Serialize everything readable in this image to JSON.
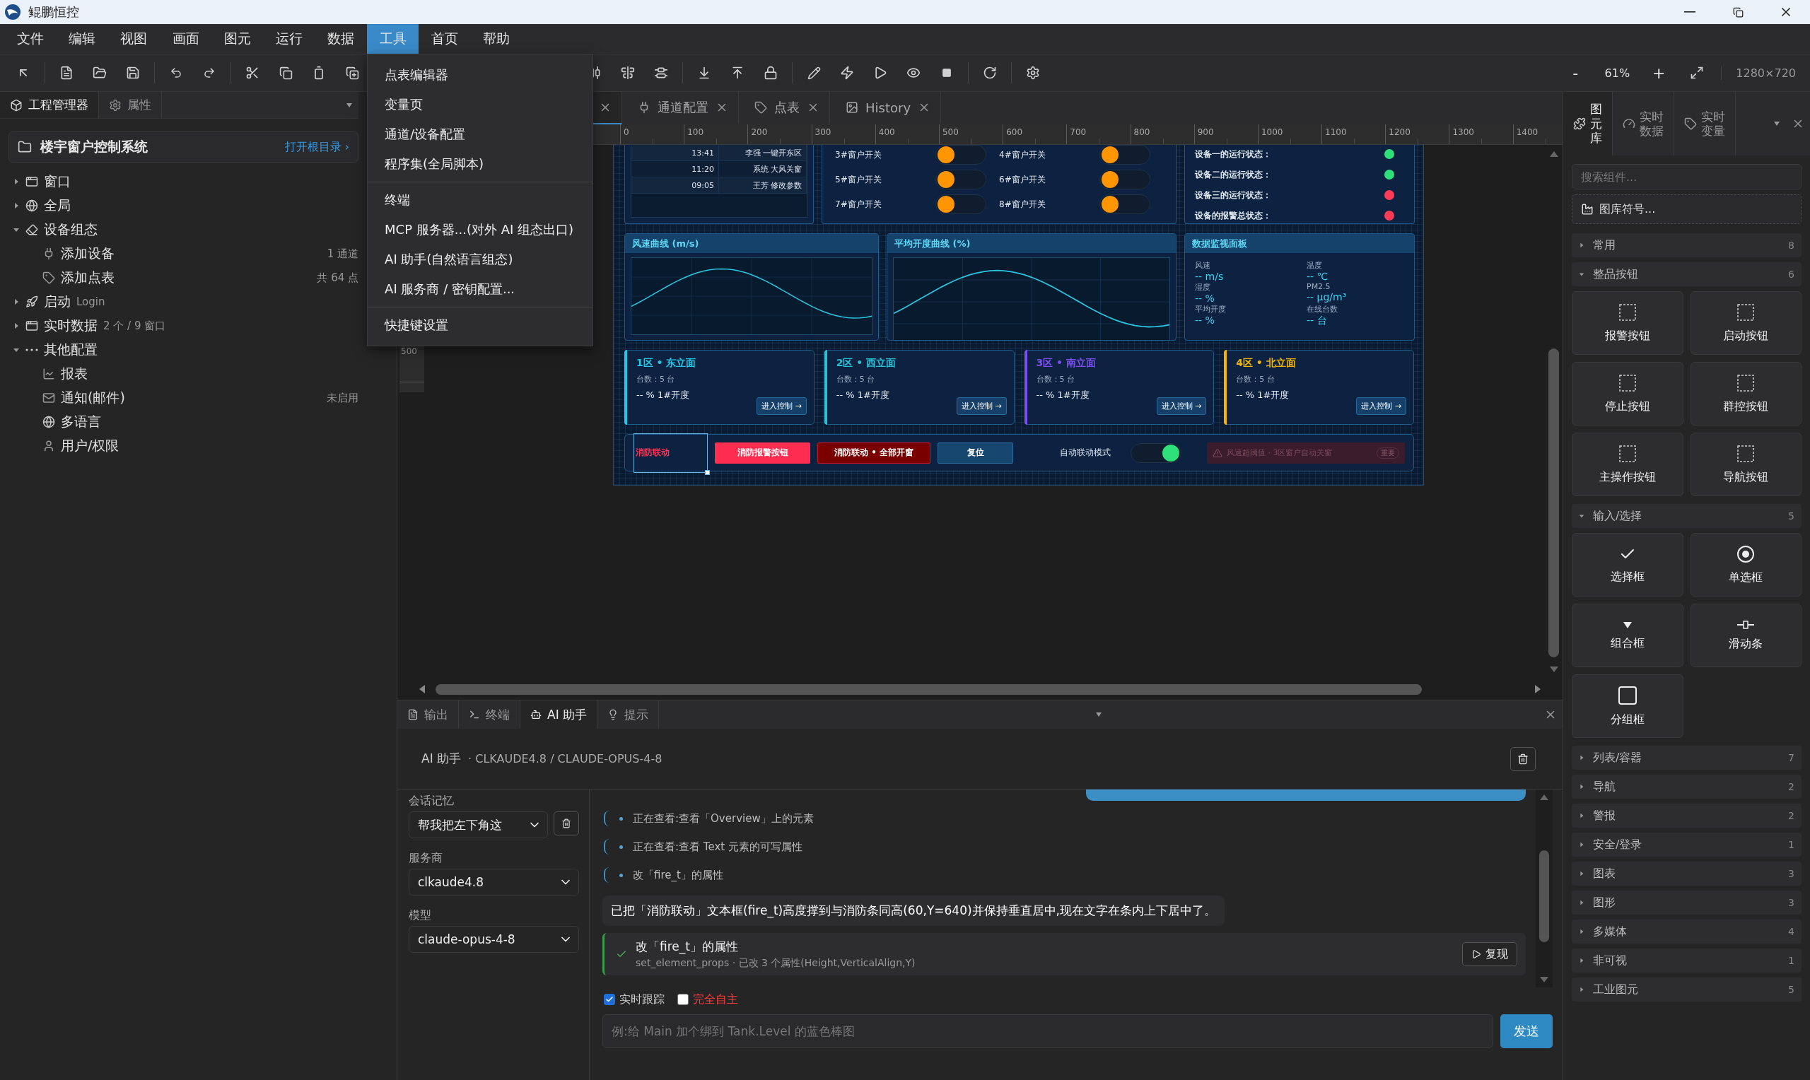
{
  "window": {
    "title": "鲲鹏恒控"
  },
  "menu": [
    {
      "label": "文件",
      "selected": false
    },
    {
      "label": "编辑",
      "selected": false
    },
    {
      "label": "视图",
      "selected": false
    },
    {
      "label": "画面",
      "selected": false
    },
    {
      "label": "图元",
      "selected": false
    },
    {
      "label": "运行",
      "selected": false
    },
    {
      "label": "数据",
      "selected": false
    },
    {
      "label": "工具",
      "selected": true
    },
    {
      "label": "首页",
      "selected": false
    },
    {
      "label": "帮助",
      "selected": false
    }
  ],
  "tools_menu": {
    "groups": [
      {
        "items": [
          "点表编辑器",
          "变量页",
          "通道/设备配置",
          "程序集(全局脚本)"
        ]
      },
      {
        "items": [
          "终端",
          "MCP 服务器...(对外 AI 组态出口)",
          "AI 助手(自然语言组态)",
          "AI 服务商 / 密钥配置..."
        ]
      },
      {
        "items": [
          "快捷键设置"
        ]
      }
    ]
  },
  "zoom": {
    "zoom_out": "-",
    "level": "61%",
    "zoom_in": "+",
    "canvas_size": "1280×720"
  },
  "left_panel": {
    "tabs": [
      {
        "label": "工程管理器",
        "kind": "box",
        "selected": true
      },
      {
        "label": "属性",
        "kind": "gear",
        "selected": false
      }
    ],
    "project": {
      "name": "楼宇窗户控制系统",
      "open_root": "打开根目录 ›"
    },
    "tree": [
      {
        "label": "窗口",
        "kind": "window",
        "expanded": false
      },
      {
        "label": "全局",
        "kind": "globe",
        "expanded": false
      },
      {
        "label": "设备组态",
        "kind": "eraser",
        "expanded": true,
        "children": [
          {
            "label": "添加设备",
            "kind": "plug",
            "note": "1 通道"
          },
          {
            "label": "添加点表",
            "kind": "tag",
            "note": "共 64 点"
          }
        ]
      },
      {
        "label": "启动",
        "kind": "rocket",
        "suffix": "Login",
        "expanded": false
      },
      {
        "label": "实时数据",
        "kind": "window",
        "suffix": "2 个 / 9 窗口",
        "expanded": false
      },
      {
        "label": "其他配置",
        "kind": "dots",
        "expanded": true,
        "children": [
          {
            "label": "报表",
            "kind": "chart"
          },
          {
            "label": "通知(邮件)",
            "kind": "mail",
            "note": "未启用"
          },
          {
            "label": "多语言",
            "kind": "globe"
          },
          {
            "label": "用户/权限",
            "kind": "user"
          }
        ]
      }
    ]
  },
  "editor_tabs": [
    {
      "kind": "covered",
      "selected": true
    },
    {
      "label": "通道配置",
      "kind": "plug",
      "selected": false
    },
    {
      "label": "点表",
      "kind": "tag",
      "selected": false
    },
    {
      "label": "History",
      "kind": "image",
      "selected": false
    }
  ],
  "ruler": {
    "ticks": [
      "0",
      "100",
      "200",
      "300",
      "400",
      "500",
      "600",
      "700",
      "800",
      "900",
      "1000",
      "1100",
      "1200",
      "1300",
      "1400"
    ]
  },
  "vertical_ruler": {
    "ticks": [
      "500"
    ]
  },
  "dashboard": {
    "log": [
      {
        "time": "13:41",
        "event": "李强 一键开东区"
      },
      {
        "time": "11:20",
        "event": "系统 大风关窗"
      },
      {
        "time": "09:05",
        "event": "王芳 修改参数"
      }
    ],
    "switches": [
      {
        "label": "3#窗户开关",
        "on": false
      },
      {
        "label": "4#窗户开关",
        "on": false
      },
      {
        "label": "5#窗户开关",
        "on": false
      },
      {
        "label": "6#窗户开关",
        "on": false
      },
      {
        "label": "7#窗户开关",
        "on": false
      },
      {
        "label": "8#窗户开关",
        "on": false
      }
    ],
    "statuses": [
      {
        "label": "设备一的运行状态：",
        "color": "#2ee07a"
      },
      {
        "label": "设备二的运行状态：",
        "color": "#2ee07a"
      },
      {
        "label": "设备三的运行状态：",
        "color": "#ff3b55"
      },
      {
        "label": "设备的报警总状态：",
        "color": "#ff3b55"
      }
    ],
    "charts": [
      {
        "title": "风速曲线 (m/s)"
      },
      {
        "title": "平均开度曲线 (%)"
      }
    ],
    "monitor": {
      "title": "数据监视面板",
      "readings": [
        {
          "label": "风速",
          "value": "-- m/s"
        },
        {
          "label": "温度",
          "value": "-- ℃"
        },
        {
          "label": "湿度",
          "value": "-- %"
        },
        {
          "label": "PM2.5",
          "value": "-- μg/m³"
        },
        {
          "label": "平均开度",
          "value": "-- %"
        },
        {
          "label": "在线台数",
          "value": "-- 台"
        }
      ]
    },
    "zones": [
      {
        "title": "1区 • 东立面",
        "color": "#22c8ea",
        "count": "台数：5 台",
        "opening": "-- % 1#开度",
        "action": "进入控制 →"
      },
      {
        "title": "2区 • 西立面",
        "color": "#26c2d6",
        "count": "台数：5 台",
        "opening": "-- % 1#开度",
        "action": "进入控制 →"
      },
      {
        "title": "3区 • 南立面",
        "color": "#7b4ff0",
        "count": "台数：5 台",
        "opening": "-- % 1#开度",
        "action": "进入控制 →"
      },
      {
        "title": "4区 • 北立面",
        "color": "#f5b400",
        "count": "台数：5 台",
        "opening": "-- % 1#开度",
        "action": "进入控制 →"
      }
    ],
    "fire": {
      "label": "消防联动",
      "selected": true,
      "buttons": [
        {
          "label": "消防报警按钮",
          "kind": "alarm"
        },
        {
          "label": "消防联动 • 全部开窗",
          "kind": "open_all"
        },
        {
          "label": "复位",
          "kind": "reset"
        }
      ],
      "auto_mode": {
        "label": "自动联动模式",
        "on": true
      },
      "alert": {
        "text": "风速超阈值 · 3区窗户自动关窗",
        "badge": "重要"
      }
    }
  },
  "library": {
    "tabs": [
      {
        "label": "图元库",
        "kind": "puzzle",
        "selected": true
      },
      {
        "label": "实时数据",
        "kind": "gauge",
        "selected": false
      },
      {
        "label": "实时变量",
        "kind": "tag",
        "selected": false
      }
    ],
    "search_placeholder": "搜索组件...",
    "symbols_button": "图库符号...",
    "categories": [
      {
        "label": "常用",
        "count": "8",
        "expanded": false
      },
      {
        "label": "整品按钮",
        "count": "6",
        "expanded": true,
        "items": [
          {
            "label": "报警按钮",
            "kind": "dashed"
          },
          {
            "label": "启动按钮",
            "kind": "dashed"
          },
          {
            "label": "停止按钮",
            "kind": "dashed"
          },
          {
            "label": "群控按钮",
            "kind": "dashed"
          },
          {
            "label": "主操作按钮",
            "kind": "dashed"
          },
          {
            "label": "导航按钮",
            "kind": "dashed"
          }
        ]
      },
      {
        "label": "输入/选择",
        "count": "5",
        "expanded": true,
        "items": [
          {
            "label": "选择框",
            "kind": "check"
          },
          {
            "label": "单选框",
            "kind": "radio"
          },
          {
            "label": "组合框",
            "kind": "combo"
          },
          {
            "label": "滑动条",
            "kind": "slider"
          },
          {
            "label": "分组框",
            "kind": "group"
          }
        ]
      },
      {
        "label": "列表/容器",
        "count": "7",
        "expanded": false
      },
      {
        "label": "导航",
        "count": "2",
        "expanded": false
      },
      {
        "label": "警报",
        "count": "2",
        "expanded": false
      },
      {
        "label": "安全/登录",
        "count": "1",
        "expanded": false
      },
      {
        "label": "图表",
        "count": "3",
        "expanded": false
      },
      {
        "label": "图形",
        "count": "3",
        "expanded": false
      },
      {
        "label": "多媒体",
        "count": "4",
        "expanded": false
      },
      {
        "label": "非可视",
        "count": "1",
        "expanded": false
      },
      {
        "label": "工业图元",
        "count": "5",
        "expanded": false
      }
    ]
  },
  "bottom_panel": {
    "tabs": [
      {
        "label": "输出",
        "kind": "file",
        "selected": false
      },
      {
        "label": "终端",
        "kind": "terminal",
        "selected": false
      },
      {
        "label": "AI 助手",
        "kind": "bot",
        "selected": true
      },
      {
        "label": "提示",
        "kind": "bulb",
        "selected": false
      }
    ],
    "assistant": {
      "title": "AI 助手",
      "model_line": "· CLKAUDE4.8 / CLAUDE-OPUS-4-8",
      "session": {
        "label": "会话记忆",
        "value": "帮我把左下角这"
      },
      "provider": {
        "label": "服务商",
        "value": "clkaude4.8"
      },
      "model": {
        "label": "模型",
        "value": "claude-opus-4-8"
      },
      "steps": [
        "正在查看:查看「Overview」上的元素",
        "正在查看:查看 Text 元素的可写属性",
        "改「fire_t」的属性"
      ],
      "reply": "已把「消防联动」文本框(fire_t)高度撑到与消防条同高(60,Y=640)并保持垂直居中,现在文字在条内上下居中了。",
      "tool_call": {
        "title": "改「fire_t」的属性",
        "detail": "set_element_props · 已改 3 个属性(Height,VerticalAlign,Y)",
        "replay": "复现"
      },
      "options": [
        {
          "label": "实时跟踪",
          "kind": "normal",
          "checked": true
        },
        {
          "label": "完全自主",
          "kind": "danger",
          "checked": false
        }
      ],
      "input_placeholder": "例:给 Main 加个绑到 Tank.Level 的蓝色棒图",
      "send": "发送"
    }
  }
}
